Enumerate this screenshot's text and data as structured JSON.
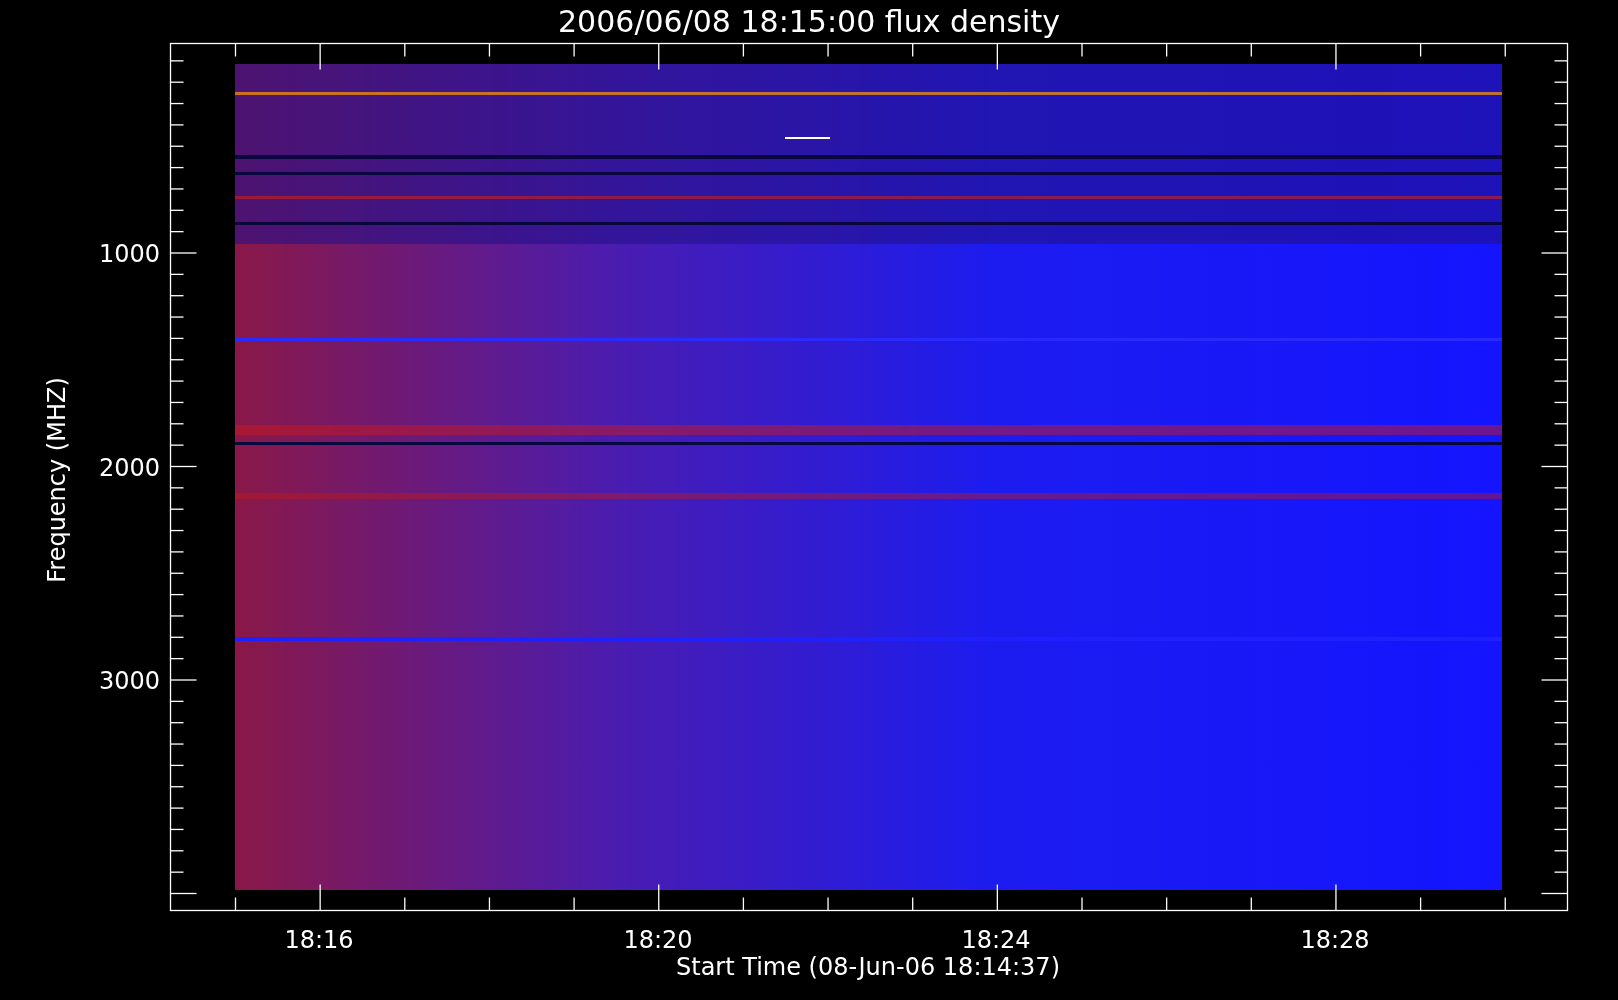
{
  "title": "2006/06/08 18:15:00 flux density",
  "y_axis": {
    "label": "Frequency (MHZ)",
    "tick_labels": [
      "1000",
      "2000",
      "3000"
    ]
  },
  "x_axis": {
    "label": "Start Time (08-Jun-06 18:14:37)",
    "tick_labels": [
      "18:16",
      "18:20",
      "18:24",
      "18:28"
    ]
  }
}
